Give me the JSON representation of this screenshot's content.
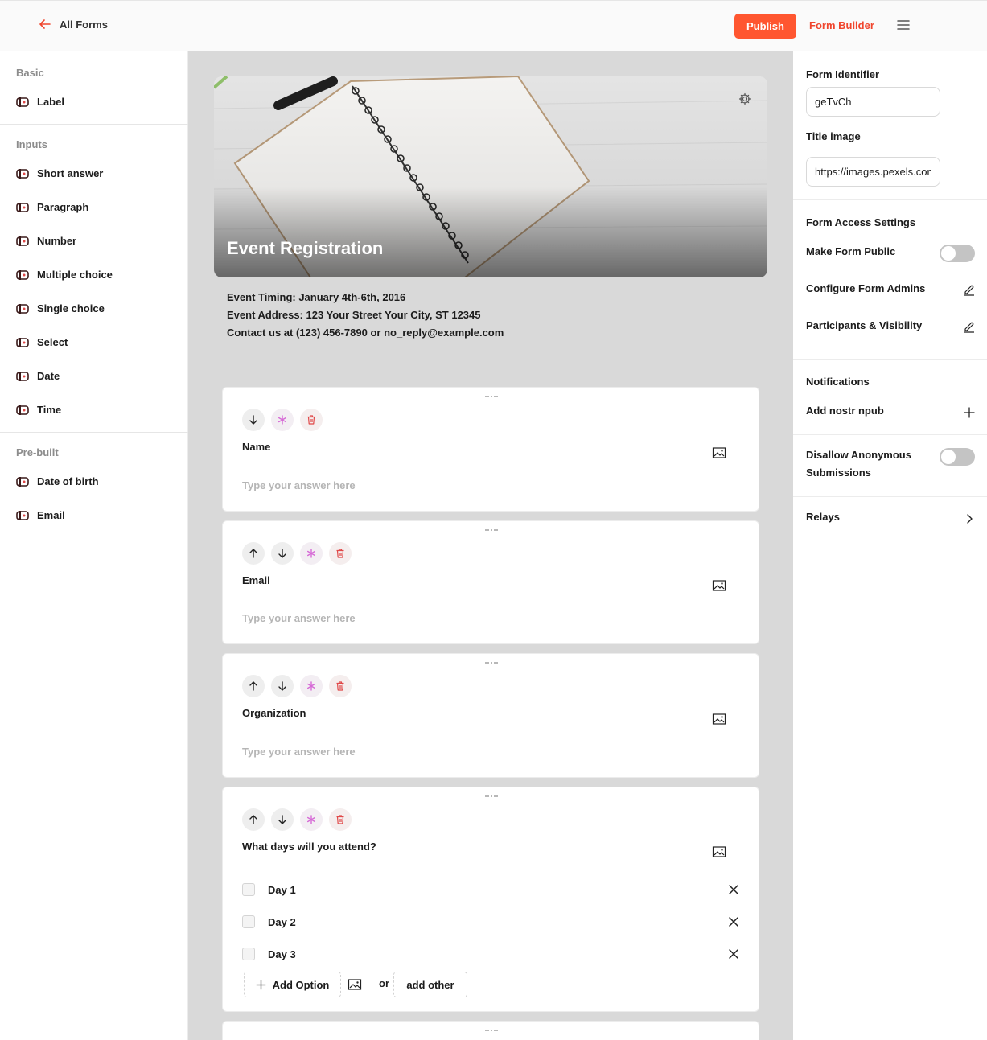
{
  "header": {
    "back_label": "All Forms",
    "publish_label": "Publish",
    "builder_label": "Form Builder"
  },
  "left": {
    "basic_title": "Basic",
    "basic_items": [
      "Label"
    ],
    "inputs_title": "Inputs",
    "input_items": [
      "Short answer",
      "Paragraph",
      "Number",
      "Multiple choice",
      "Single choice",
      "Select",
      "Date",
      "Time"
    ],
    "prebuilt_title": "Pre-built",
    "prebuilt_items": [
      "Date of birth",
      "Email"
    ]
  },
  "form": {
    "title": "Event Registration",
    "description": [
      "Event Timing: January 4th-6th, 2016",
      "Event Address: 123 Your Street Your City, ST 12345",
      "Contact us at (123) 456-7890 or no_reply@example.com"
    ],
    "placeholder": "Type your answer here",
    "questions": [
      {
        "label": "Name"
      },
      {
        "label": "Email"
      },
      {
        "label": "Organization"
      },
      {
        "label": "What days will you attend?",
        "options": [
          "Day 1",
          "Day 2",
          "Day 3"
        ]
      }
    ],
    "add_option_label": "Add Option",
    "or_label": "or",
    "add_other_label": "add other"
  },
  "right": {
    "form_identifier_label": "Form Identifier",
    "form_identifier_value": "geTvCh",
    "title_image_label": "Title image",
    "title_image_value": "https://images.pexels.com",
    "access_title": "Form Access Settings",
    "make_public_label": "Make Form Public",
    "make_public_on": false,
    "admins_label": "Configure Form Admins",
    "participants_label": "Participants & Visibility",
    "notifications_title": "Notifications",
    "npub_label": "Add nostr npub",
    "disallow_label_1": "Disallow Anonymous",
    "disallow_label_2": "Submissions",
    "disallow_on": false,
    "relays_label": "Relays"
  },
  "colors": {
    "accent": "#ff5630",
    "accent_text": "#f0452d",
    "required_star": "#d66ad6",
    "delete": "#e04848",
    "canvas": "#d9d9d9"
  },
  "icons": {
    "back": "arrow-left-icon",
    "menu": "hamburger-icon",
    "field": "field-type-icon",
    "settings": "gear-icon",
    "edit": "pencil-icon",
    "add": "plus-icon",
    "chevron": "chevron-right-icon",
    "image": "image-icon",
    "close": "close-icon",
    "up": "arrow-up-icon",
    "down": "arrow-down-icon",
    "required": "asterisk-icon",
    "delete": "trash-icon"
  }
}
